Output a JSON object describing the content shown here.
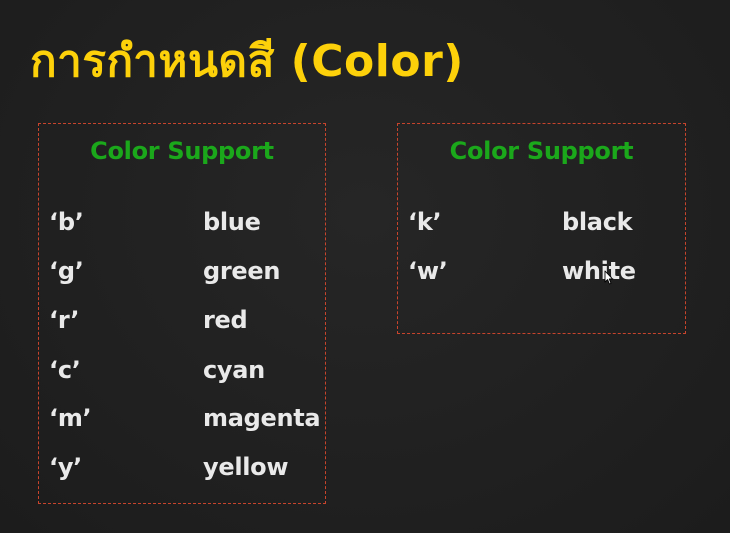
{
  "slide": {
    "title": "การกำหนดสี (Color)"
  },
  "colors": {
    "title": "#fdd10a",
    "heading": "#1ba81b",
    "border": "#c8442c",
    "text": "#e9e9e9",
    "background": "#212121"
  },
  "left_panel": {
    "heading": "Color Support",
    "rows": [
      {
        "code": "‘b’",
        "name": "blue"
      },
      {
        "code": "‘g’",
        "name": "green"
      },
      {
        "code": "‘r’",
        "name": "red"
      },
      {
        "code": "‘c’",
        "name": "cyan"
      },
      {
        "code": "‘m’",
        "name": "magenta"
      },
      {
        "code": "‘y’",
        "name": "yellow"
      }
    ]
  },
  "right_panel": {
    "heading": "Color Support",
    "rows": [
      {
        "code": "‘k’",
        "name": "black"
      },
      {
        "code": "‘w’",
        "name": "white"
      }
    ]
  },
  "cursor_icon": "mouse-pointer-icon"
}
